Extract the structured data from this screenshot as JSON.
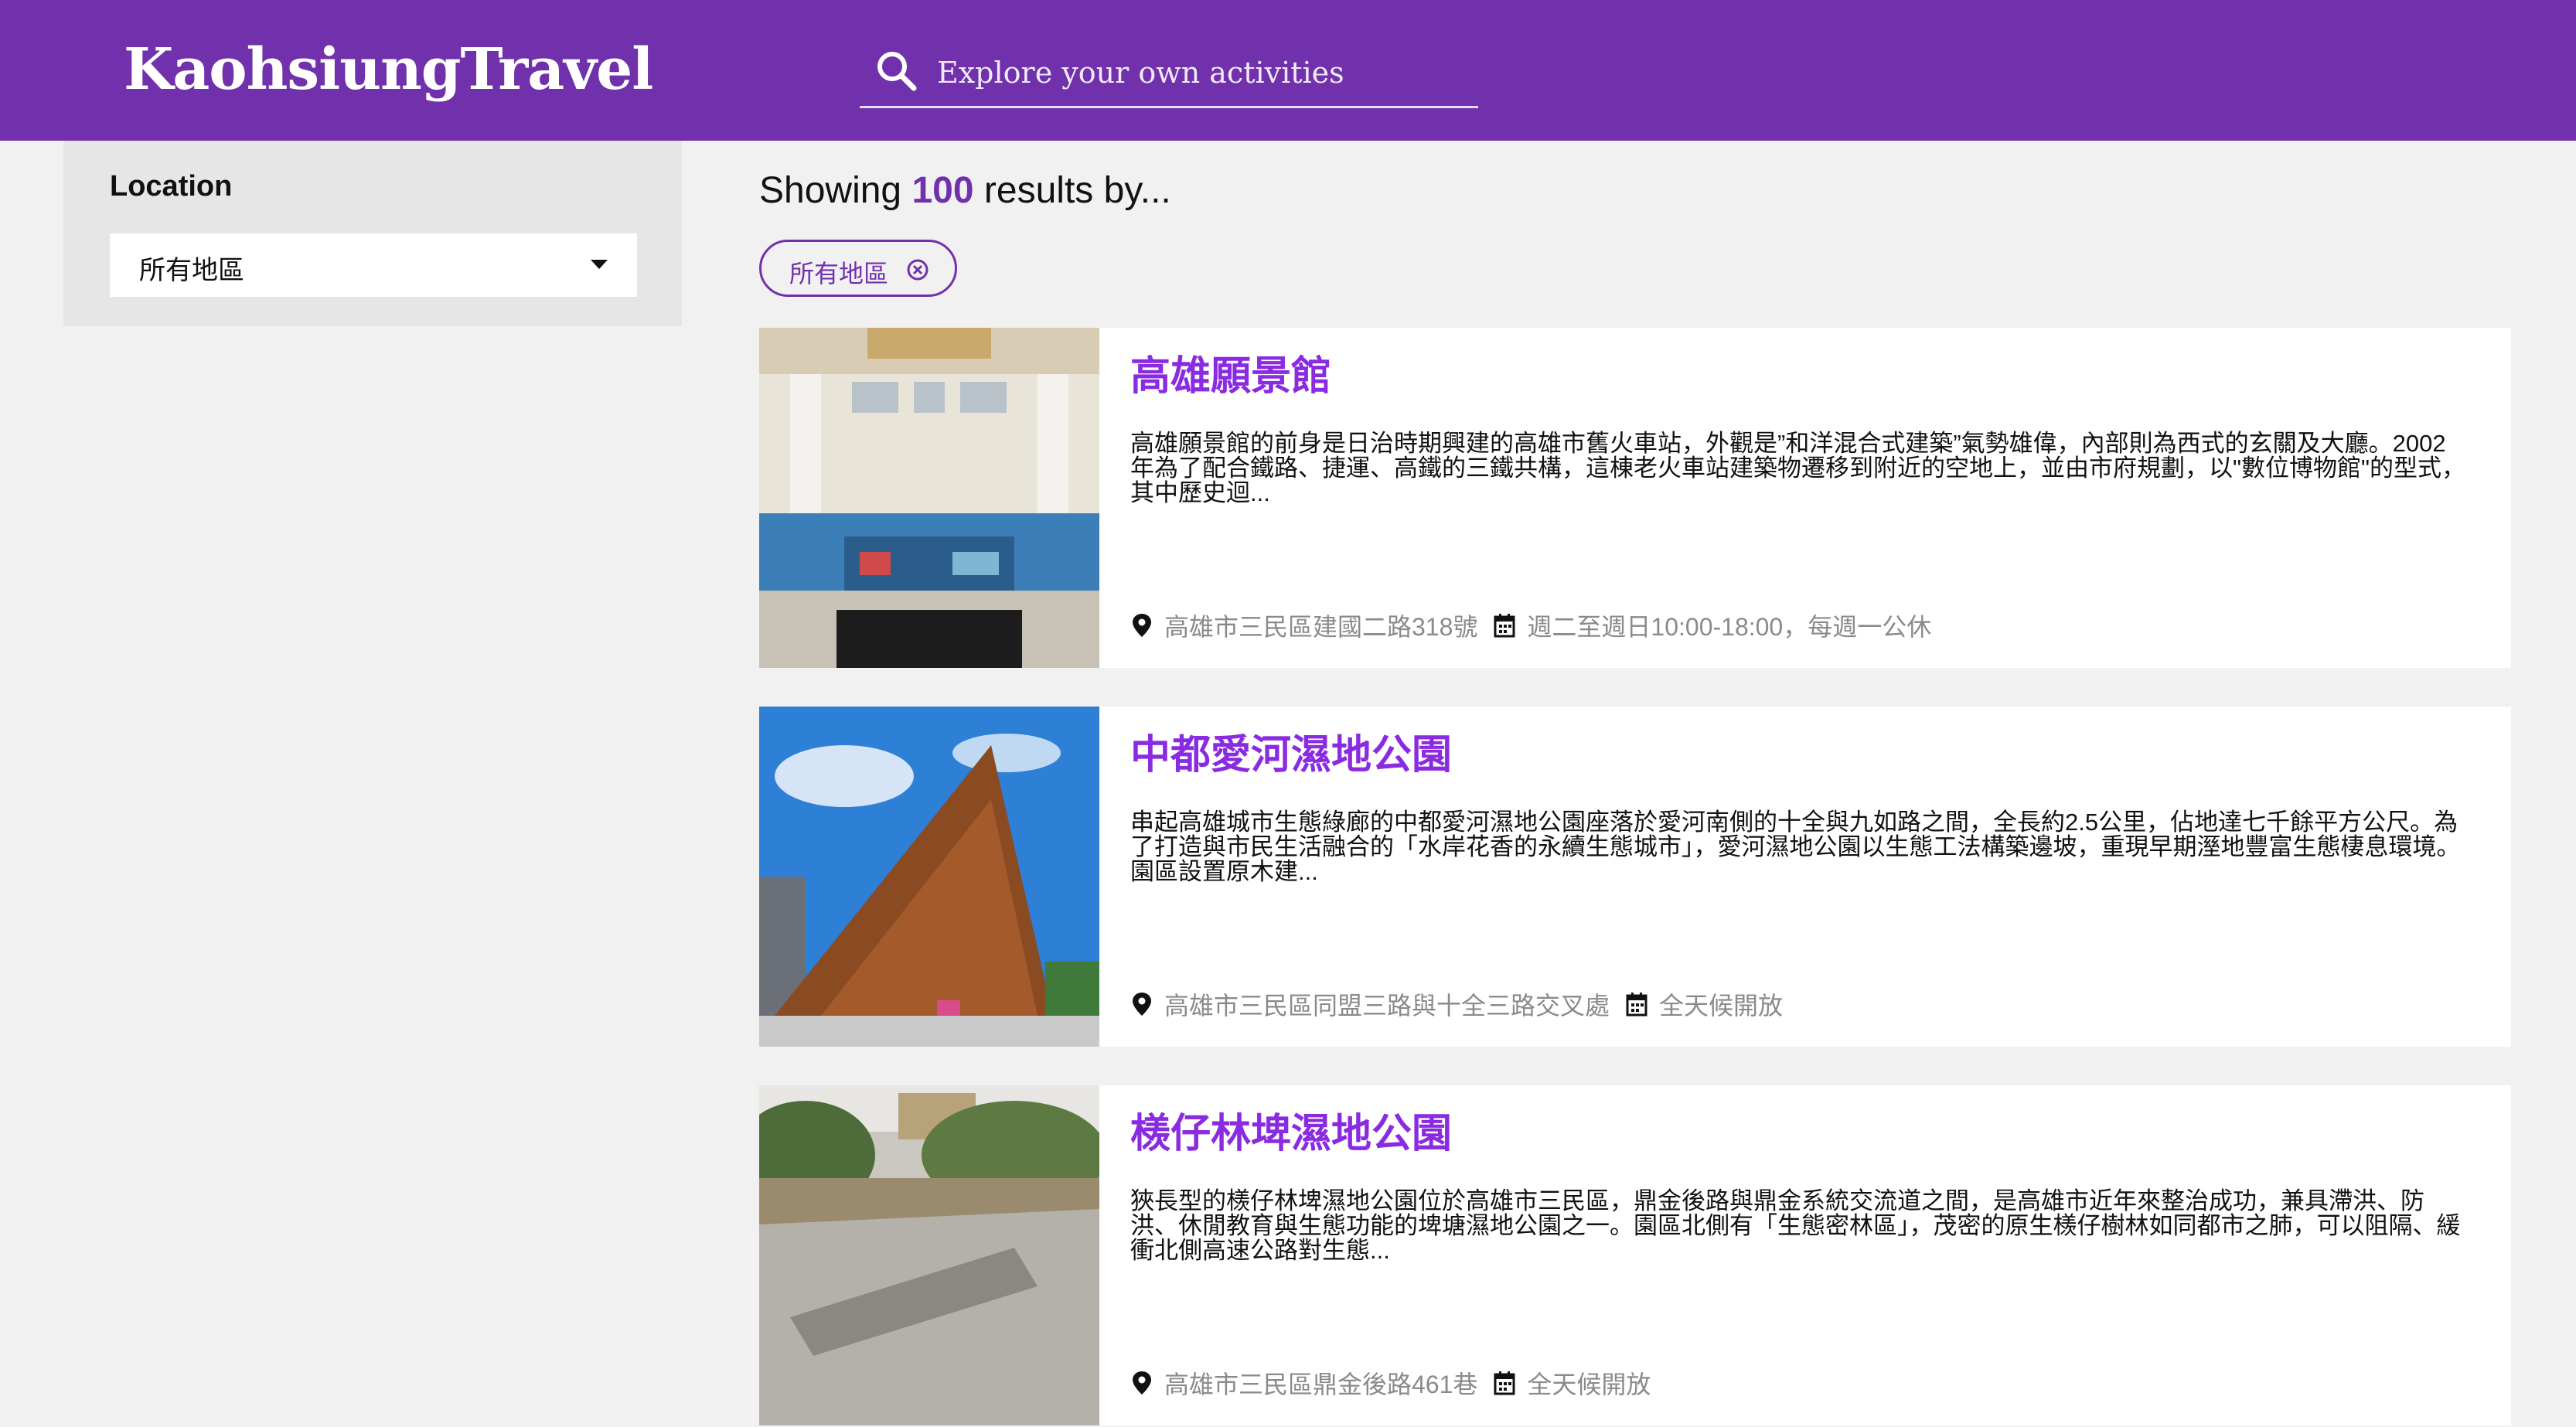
{
  "header": {
    "logo": "KaohsiungTravel",
    "search_placeholder": "Explore your own activities"
  },
  "sidebar": {
    "location_label": "Location",
    "location_selected": "所有地區"
  },
  "results": {
    "prefix": "Showing",
    "count": "100",
    "suffix": "results by..."
  },
  "filter_chip": {
    "label": "所有地區"
  },
  "cards": [
    {
      "name": "高雄願景館",
      "description": "高雄願景館的前身是日治時期興建的高雄市舊火車站，外觀是”和洋混合式建築”氣勢雄偉，內部則為西式的玄關及大廳。2002年為了配合鐵路、捷運、高鐵的三鐵共構，這棟老火車站建築物遷移到附近的空地上，並由市府規劃，以\"數位博物館\"的型式，其中歷史迴...",
      "address": "高雄市三民區建國二路318號",
      "hours": "週二至週日10:00-18:00，每週一公休"
    },
    {
      "name": "中都愛河濕地公園",
      "description": "串起高雄城市生態綠廊的中都愛河濕地公園座落於愛河南側的十全與九如路之間，全長約2.5公里，佔地達七千餘平方公尺。為了打造與市民生活融合的「水岸花香的永續生態城市」，愛河濕地公園以生態工法構築邊坡，重現早期溼地豐富生態棲息環境。園區設置原木建...",
      "address": "高雄市三民區同盟三路與十全三路交叉處",
      "hours": "全天候開放"
    },
    {
      "name": "檨仔林埤濕地公園",
      "description": "狹長型的檨仔林埤濕地公園位於高雄市三民區，鼎金後路與鼎金系統交流道之間，是高雄市近年來整治成功，兼具滯洪、防洪、休閒教育與生態功能的埤塘濕地公園之一。園區北側有「生態密林區」，茂密的原生檨仔樹林如同都市之肺，可以阻隔、緩衝北側高速公路對生態...",
      "address": "高雄市三民區鼎金後路461巷",
      "hours": "全天候開放"
    }
  ],
  "colors": {
    "brand": "#7131ac",
    "title": "#8a2be2",
    "background": "#f1f1f1"
  }
}
